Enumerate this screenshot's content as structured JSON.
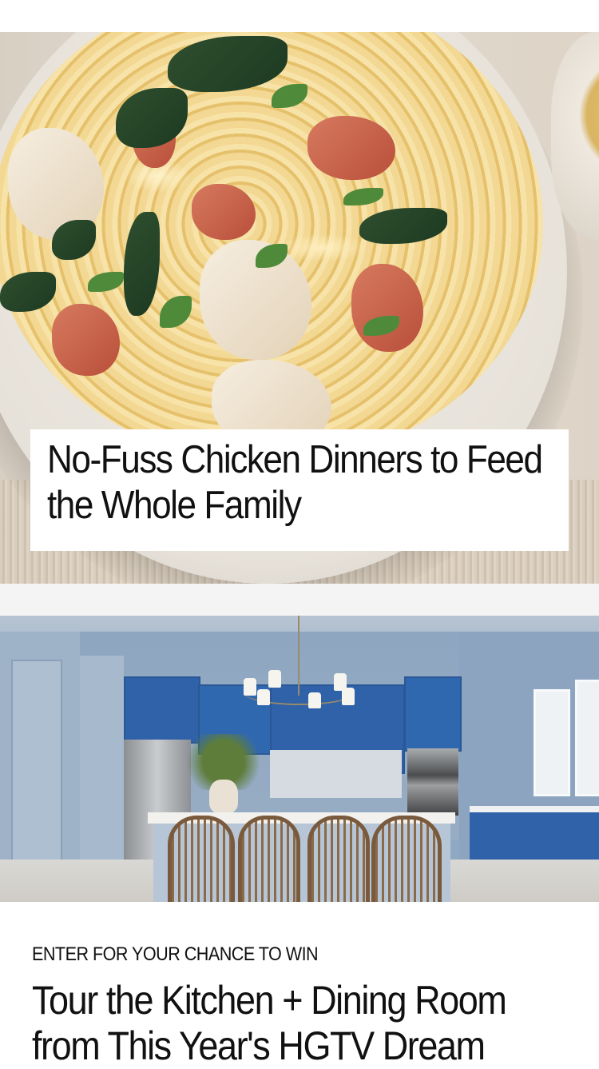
{
  "feed": {
    "cards": [
      {
        "image_alt": "Creamy pasta with chicken, bacon and spinach",
        "title": "No-Fuss Chicken Dinners to Feed the Whole Family"
      },
      {
        "image_alt": "Blue kitchen with island and stools",
        "eyebrow": "ENTER FOR YOUR CHANCE TO WIN",
        "title": "Tour the Kitchen + Dining Room from This Year's HGTV Dream"
      }
    ]
  },
  "colors": {
    "kitchen_cabinet_blue": "#2f62a8",
    "title_text": "#111111",
    "divider": "#f4f4f4"
  }
}
